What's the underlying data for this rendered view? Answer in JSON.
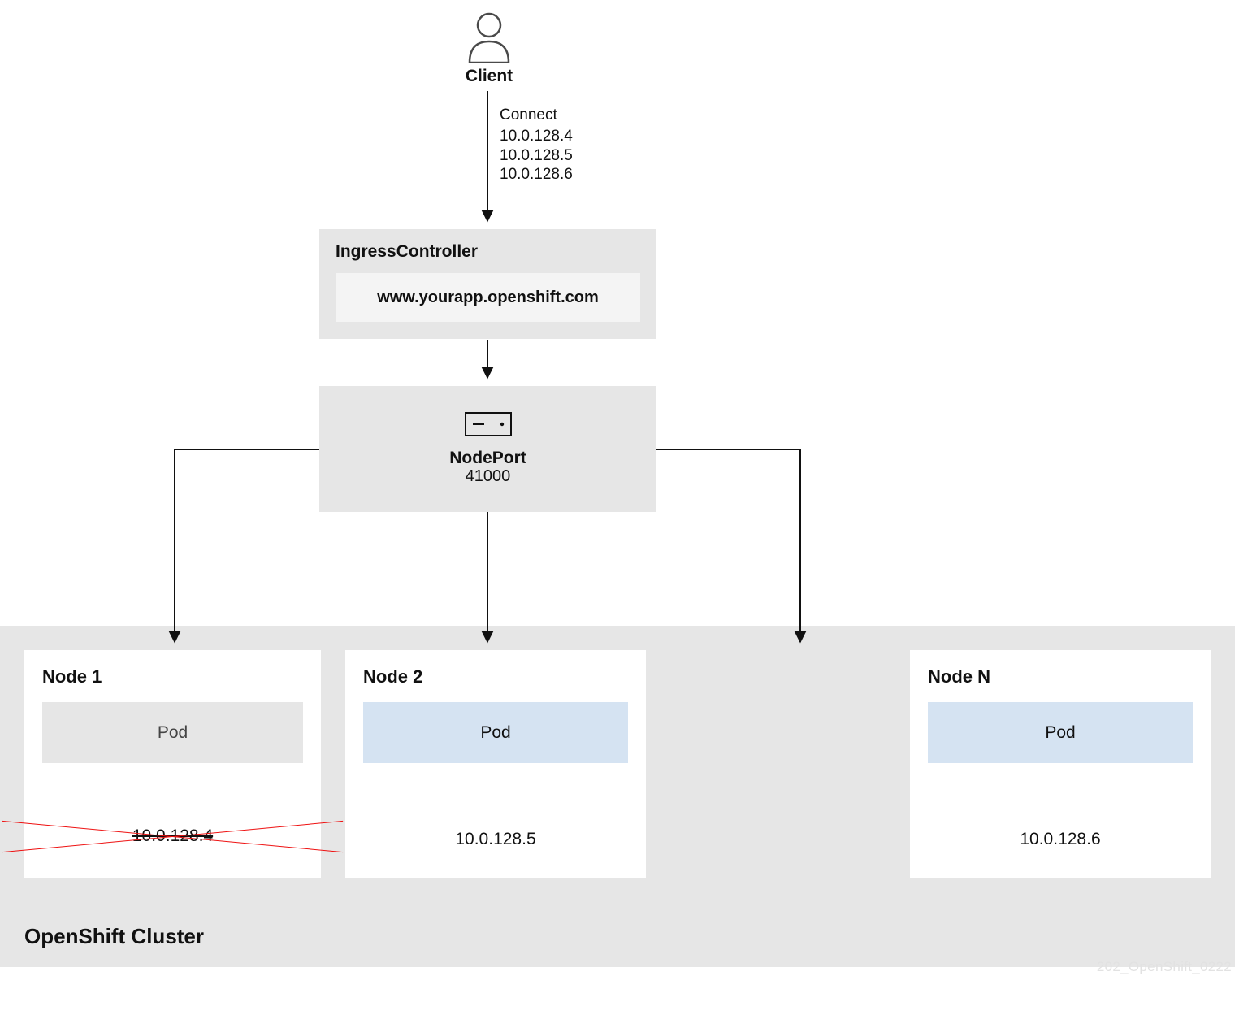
{
  "client": {
    "label": "Client"
  },
  "connect": {
    "label": "Connect",
    "ips": [
      "10.0.128.4",
      "10.0.128.5",
      "10.0.128.6"
    ]
  },
  "ingress": {
    "title": "IngressController",
    "url": "www.yourapp.openshift.com"
  },
  "nodeport": {
    "title": "NodePort",
    "port": "41000"
  },
  "cluster": {
    "title": "OpenShift Cluster",
    "nodes": [
      {
        "name": "Node 1",
        "pod_label": "Pod",
        "ip": "10.0.128.4",
        "pod_style": "gray",
        "ip_crossed": true
      },
      {
        "name": "Node 2",
        "pod_label": "Pod",
        "ip": "10.0.128.5",
        "pod_style": "blue",
        "ip_crossed": false
      },
      {
        "name": "Node N",
        "pod_label": "Pod",
        "ip": "10.0.128.6",
        "pod_style": "blue",
        "ip_crossed": false
      }
    ]
  },
  "footer": {
    "code": "202_OpenShift_0222"
  }
}
